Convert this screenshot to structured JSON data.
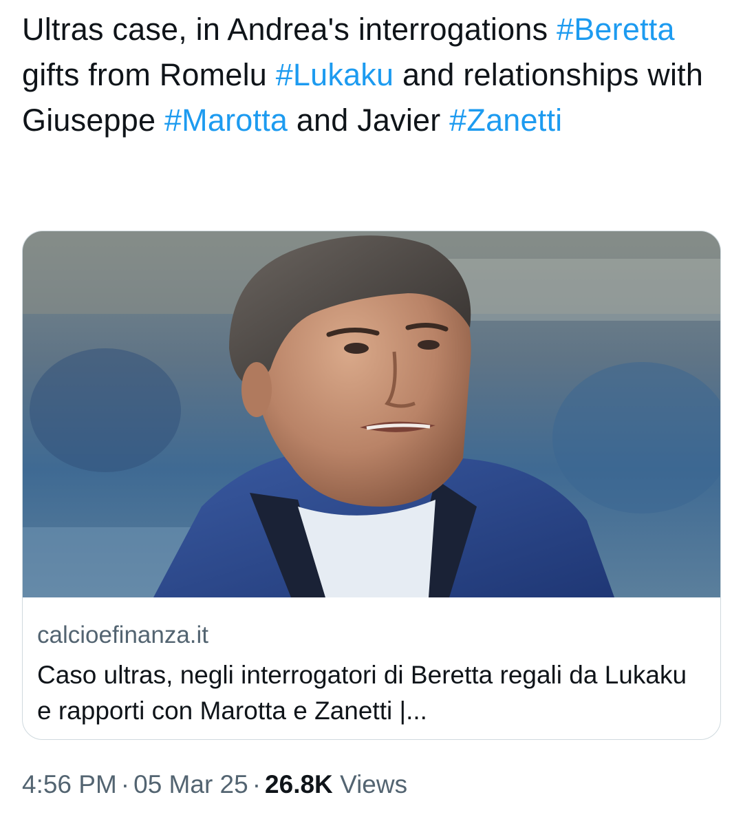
{
  "tweet": {
    "segments": [
      {
        "text": "Ultras case, in Andrea's interrogations ",
        "type": "text"
      },
      {
        "text": "#Beretta",
        "type": "hashtag"
      },
      {
        "text": " gifts from Romelu ",
        "type": "text"
      },
      {
        "text": "#Lukaku",
        "type": "hashtag"
      },
      {
        "text": " and relationships with Giuseppe ",
        "type": "text"
      },
      {
        "text": "#Marotta",
        "type": "hashtag"
      },
      {
        "text": " and Javier ",
        "type": "text"
      },
      {
        "text": "#Zanetti",
        "type": "hashtag"
      }
    ],
    "hashtag_color": "#1d9bf0"
  },
  "card": {
    "domain": "calcioefinanza.it",
    "title": "Caso ultras, negli interrogatori di Beretta regali da Lukaku e rapporti con Marotta e Zanetti |..."
  },
  "meta": {
    "time": "4:56 PM",
    "separator": "·",
    "date": "05 Mar 25",
    "views_count": "26.8K",
    "views_label": "Views"
  }
}
